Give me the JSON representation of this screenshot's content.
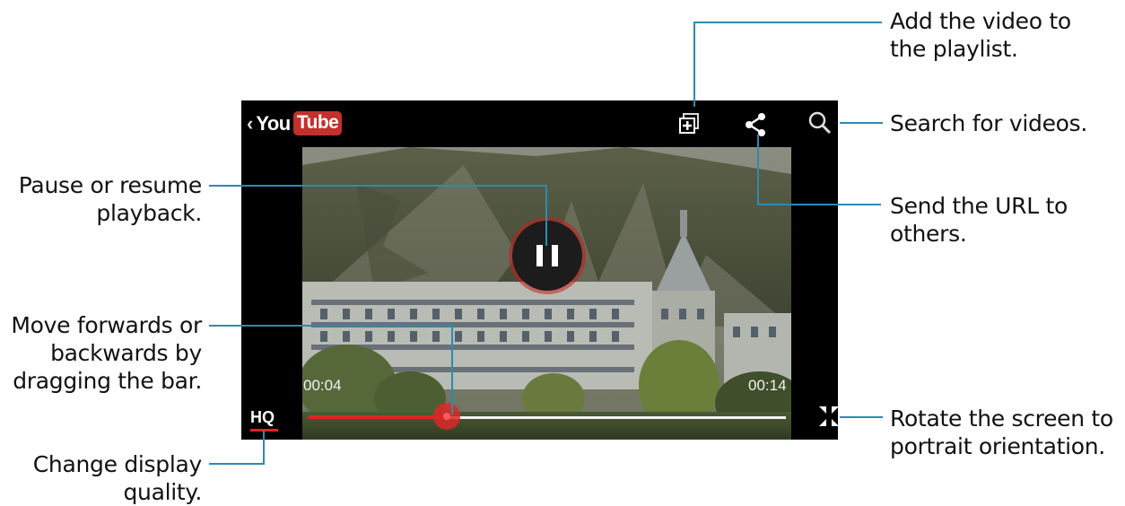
{
  "player": {
    "logo": {
      "chevron": "‹",
      "you": "You",
      "tube": "Tube"
    },
    "current_time": "00:04",
    "total_time": "00:14",
    "progress": 0.29,
    "quality_label": "HQ",
    "icons": {
      "back": "chevron-left-icon",
      "add_playlist": "add-to-playlist-icon",
      "share": "share-icon",
      "search": "search-icon",
      "pause": "pause-icon",
      "rotate": "rotate-shrink-icon"
    }
  },
  "callouts": {
    "add_playlist": {
      "line1": "Add the video to",
      "line2": "the playlist."
    },
    "search": {
      "line1": "Search for videos."
    },
    "share": {
      "line1": "Send the URL to",
      "line2": "others."
    },
    "rotate": {
      "line1": "Rotate the screen to",
      "line2": "portrait orientation."
    },
    "pause": {
      "line1": "Pause or resume",
      "line2": "playback."
    },
    "seek": {
      "line1": "Move forwards or",
      "line2": "backwards by",
      "line3": "dragging the bar."
    },
    "quality": {
      "line1": "Change display",
      "line2": "quality."
    }
  },
  "colors": {
    "accent": "#2b8bb3",
    "progress": "#e02424",
    "brand": "#c4302b"
  }
}
